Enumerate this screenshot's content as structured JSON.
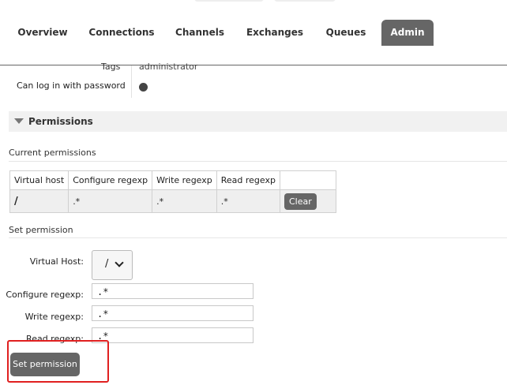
{
  "nav": {
    "tabs": [
      {
        "label": "Overview",
        "active": false
      },
      {
        "label": "Connections",
        "active": false
      },
      {
        "label": "Channels",
        "active": false
      },
      {
        "label": "Exchanges",
        "active": false
      },
      {
        "label": "Queues",
        "active": false
      },
      {
        "label": "Admin",
        "active": true
      }
    ]
  },
  "user": {
    "tags_label": "Tags",
    "tags_value": "administrator",
    "login_label": "Can log in with password"
  },
  "permissions": {
    "section_title": "Permissions",
    "current_title": "Current permissions",
    "columns": [
      "Virtual host",
      "Configure regexp",
      "Write regexp",
      "Read regexp"
    ],
    "rows": [
      {
        "vhost": "/",
        "configure": ".*",
        "write": ".*",
        "read": ".*",
        "action": "Clear"
      }
    ]
  },
  "set_permission": {
    "title": "Set permission",
    "vhost_label": "Virtual Host:",
    "vhost_value": "/",
    "configure_label": "Configure regexp:",
    "configure_value": ".*",
    "write_label": "Write regexp:",
    "write_value": ".*",
    "read_label": "Read regexp:",
    "read_value": ".*",
    "submit_label": "Set permission"
  },
  "colors": {
    "active_tab": "#666666",
    "button": "#666666",
    "highlight": "#e02020"
  }
}
